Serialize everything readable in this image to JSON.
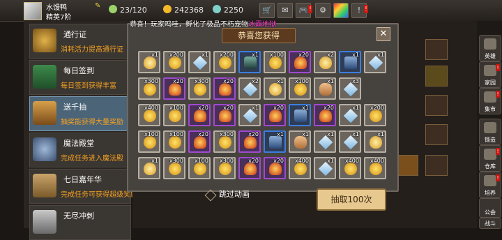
{
  "player": {
    "name": "水馒鸭",
    "rank": "精英7阶"
  },
  "resources": {
    "stamina": "23/120",
    "coins": "242368",
    "gems": "2250"
  },
  "top_icons": [
    "shop-cart-icon",
    "mail-icon",
    "gamepad-icon",
    "gear-icon",
    "rainbow-icon",
    "alert-icon"
  ],
  "left_menu": [
    {
      "title": "通行证",
      "desc": "消耗活力提高通行证"
    },
    {
      "title": "每日签到",
      "desc": "每日签到获得丰富"
    },
    {
      "title": "送千抽",
      "desc": "抽奖能获得大量奖励"
    },
    {
      "title": "魔法殿堂",
      "desc": "完成任务进入魔法殿"
    },
    {
      "title": "七日嘉年华",
      "desc": "完成任务可获得超级奖励"
    },
    {
      "title": "无尽冲刺",
      "desc": ""
    }
  ],
  "right_menu": [
    "英雄",
    "家园",
    "集市",
    "锻造",
    "仓库",
    "培养",
    "公会",
    "战斗"
  ],
  "modal": {
    "title": "恭喜您获得",
    "close": "✕",
    "notice_prefix": "恭喜！玩家鸣哇，孵化了极品不朽宠物",
    "notice_pet": "冰霜地狱",
    "grid": [
      [
        {
          "q": "x1",
          "i": "egg",
          "c": "white"
        },
        {
          "q": "x200",
          "i": "coin",
          "c": "white"
        },
        {
          "q": "x1",
          "i": "diamond",
          "c": "white"
        },
        {
          "q": "x200",
          "i": "coin",
          "c": "white"
        },
        {
          "q": "x1",
          "i": "shield",
          "c": "blue"
        },
        {
          "q": "x100",
          "i": "coin",
          "c": "white"
        },
        {
          "q": "x20",
          "i": "fire",
          "c": "purple"
        },
        {
          "q": "x2",
          "i": "egg",
          "c": "white"
        },
        {
          "q": "x1",
          "i": "gem",
          "c": "blue"
        },
        {
          "q": "x1",
          "i": "diamond",
          "c": "white"
        }
      ],
      [
        {
          "q": "x300",
          "i": "coin",
          "c": "white"
        },
        {
          "q": "x20",
          "i": "fire",
          "c": "purple"
        },
        {
          "q": "x300",
          "i": "coin",
          "c": "white"
        },
        {
          "q": "x20",
          "i": "fire",
          "c": "purple"
        },
        {
          "q": "x2",
          "i": "diamond",
          "c": "white"
        },
        {
          "q": "x1",
          "i": "egg",
          "c": "white"
        },
        {
          "q": "x100",
          "i": "coin",
          "c": "white"
        },
        {
          "q": "x1",
          "i": "bone",
          "c": "white"
        },
        {
          "q": "x3",
          "i": "diamond",
          "c": "white"
        },
        {
          "q": "",
          "i": "",
          "c": "none"
        }
      ],
      [
        {
          "q": "x400",
          "i": "coin",
          "c": "white"
        },
        {
          "q": "x100",
          "i": "coin",
          "c": "white"
        },
        {
          "q": "x20",
          "i": "fire",
          "c": "purple"
        },
        {
          "q": "x20",
          "i": "fire",
          "c": "purple"
        },
        {
          "q": "x1",
          "i": "diamond",
          "c": "white"
        },
        {
          "q": "x20",
          "i": "fire",
          "c": "purple"
        },
        {
          "q": "x1",
          "i": "gem",
          "c": "blue"
        },
        {
          "q": "x20",
          "i": "fire",
          "c": "purple"
        },
        {
          "q": "x1",
          "i": "diamond",
          "c": "white"
        },
        {
          "q": "x200",
          "i": "coin",
          "c": "white"
        }
      ],
      [
        {
          "q": "x100",
          "i": "coin",
          "c": "white"
        },
        {
          "q": "x100",
          "i": "coin",
          "c": "white"
        },
        {
          "q": "x20",
          "i": "fire",
          "c": "purple"
        },
        {
          "q": "x300",
          "i": "coin",
          "c": "white"
        },
        {
          "q": "x20",
          "i": "fire",
          "c": "purple"
        },
        {
          "q": "x1",
          "i": "gem",
          "c": "blue"
        },
        {
          "q": "x1",
          "i": "bone",
          "c": "white"
        },
        {
          "q": "x1",
          "i": "diamond",
          "c": "white"
        },
        {
          "q": "x1",
          "i": "diamond",
          "c": "white"
        },
        {
          "q": "x1",
          "i": "egg",
          "c": "white"
        }
      ],
      [
        {
          "q": "x1",
          "i": "egg",
          "c": "white"
        },
        {
          "q": "x300",
          "i": "coin",
          "c": "white"
        },
        {
          "q": "x100",
          "i": "coin",
          "c": "white"
        },
        {
          "q": "x300",
          "i": "coin",
          "c": "white"
        },
        {
          "q": "x20",
          "i": "fire",
          "c": "purple"
        },
        {
          "q": "x20",
          "i": "fire",
          "c": "purple"
        },
        {
          "q": "x400",
          "i": "coin",
          "c": "white"
        },
        {
          "q": "x1",
          "i": "diamond",
          "c": "white"
        },
        {
          "q": "x400",
          "i": "coin",
          "c": "white"
        },
        {
          "q": "x400",
          "i": "coin",
          "c": "white"
        }
      ]
    ]
  },
  "bottom": {
    "skip": "跳过动画",
    "draw_button": "抽取100次"
  }
}
